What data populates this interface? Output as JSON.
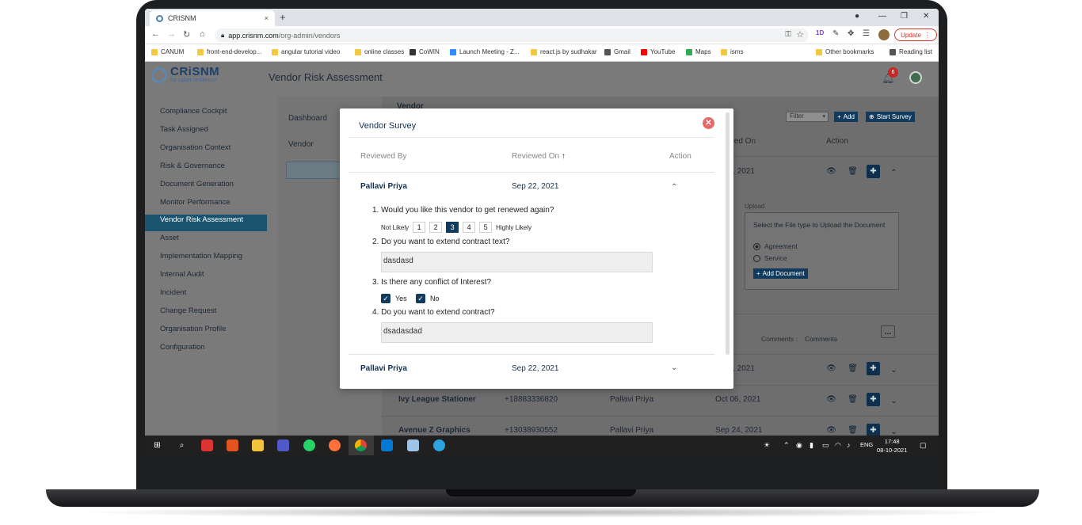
{
  "browser": {
    "tab_title": "CRISNM",
    "tab_close": "×",
    "new_tab": "+",
    "url_host": "app.crisnm.com",
    "url_path": "/org-admin/vendors",
    "update_label": "Update",
    "bookmarks": [
      {
        "label": "CANUM",
        "color": "#f2c744"
      },
      {
        "label": "front-end-develop...",
        "color": "#f2c744"
      },
      {
        "label": "angular tutorial video",
        "color": "#f2c744"
      },
      {
        "label": "online classes",
        "color": "#f2c744"
      },
      {
        "label": "CoWIN",
        "color": "#333333"
      },
      {
        "label": "Launch Meeting - Z...",
        "color": "#2d8cff"
      },
      {
        "label": "react.js by sudhakar",
        "color": "#f2c744"
      },
      {
        "label": "Gmail",
        "color": "#555555"
      },
      {
        "label": "YouTube",
        "color": "#ff0000"
      },
      {
        "label": "Maps",
        "color": "#34a853"
      },
      {
        "label": "isms",
        "color": "#f2c744"
      },
      {
        "label": "Other bookmarks",
        "color": "#f2c744"
      },
      {
        "label": "Reading list",
        "color": "#555555"
      }
    ]
  },
  "app": {
    "logo_text": "CRiSNM",
    "logo_sub": "for cyber resilience",
    "page_title": "Vendor Risk Assessment",
    "notification_count": "6",
    "sidebar": [
      "Compliance Cockpit",
      "Task Assigned",
      "Organisation Context",
      "Risk & Governance",
      "Document Generation",
      "Monitor Performance",
      "Vendor Risk Assessment",
      "Asset",
      "Implementation Mapping",
      "Internal Audit",
      "Incident",
      "Change Request",
      "Organisation Profile",
      "Configuration"
    ],
    "sidebar_active": "Vendor Risk Assessment",
    "subnav": [
      "Dashboard",
      "Vendor"
    ],
    "background": {
      "section_title": "Vendor",
      "filter_label": "Filter",
      "add_label": "Add",
      "start_survey_label": "Start Survey",
      "reviewed_on_header": "ewed On",
      "action_header": "Action",
      "row1_date": "22, 2021",
      "upload_label": "Upload",
      "upload_prompt": "Select the File type to Upload the Document",
      "upload_options": [
        "Agreement",
        "Service"
      ],
      "add_document_label": "Add Document",
      "comments_label": "Comments :",
      "comments_value": "Comments",
      "more_icon": "...",
      "rows": [
        {
          "vendor": "",
          "phone": "",
          "reviewer": "",
          "date": "20, 2021"
        },
        {
          "vendor": "Ivy League Stationer",
          "phone": "+18883336820",
          "reviewer": "Pallavi Priya",
          "date": "Oct 06, 2021"
        },
        {
          "vendor": "Avenue Z Graphics",
          "phone": "+13038930552",
          "reviewer": "Pallavi Priya",
          "date": "Sep 24, 2021"
        }
      ]
    }
  },
  "modal": {
    "title": "Vendor Survey",
    "headers": {
      "reviewed_by": "Reviewed By",
      "reviewed_on": "Reviewed On",
      "action": "Action"
    },
    "rows": [
      {
        "reviewer": "Pallavi Priya",
        "date": "Sep 22, 2021"
      },
      {
        "reviewer": "Pallavi Priya",
        "date": "Sep 22, 2021"
      }
    ],
    "questions": {
      "q1": "1. Would you like this vendor to get renewed again?",
      "q2": "2. Do you want to extend contract text?",
      "q3": "3. Is there any conflict of Interest?",
      "q4": "4. Do you want to extend contract?"
    },
    "scale": {
      "low_label": "Not Likely",
      "high_label": "Highly Likely",
      "options": [
        "1",
        "2",
        "3",
        "4",
        "5"
      ],
      "selected": "3"
    },
    "answers": {
      "a2": "dasdasd",
      "a4": "dsadasdad"
    },
    "conflict_options": [
      "Yes",
      "No"
    ]
  },
  "taskbar": {
    "lang": "ENG",
    "time": "17:48",
    "date": "08-10-2021"
  }
}
